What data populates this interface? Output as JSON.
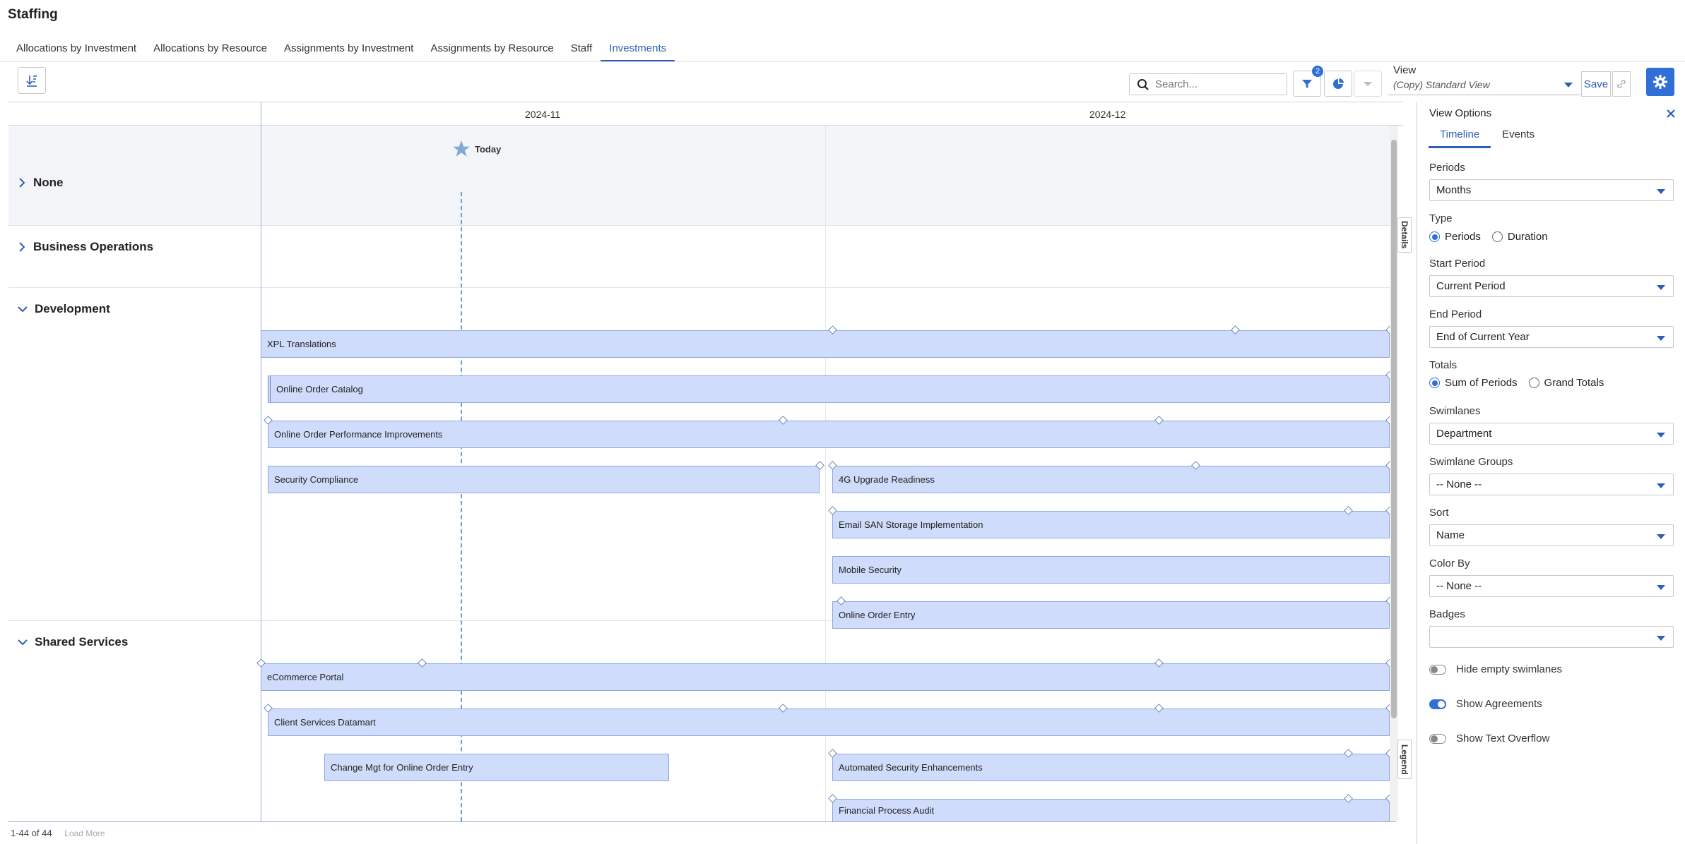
{
  "page": {
    "title": "Staffing"
  },
  "tabs": [
    {
      "label": "Allocations by Investment"
    },
    {
      "label": "Allocations by Resource"
    },
    {
      "label": "Assignments by Investment"
    },
    {
      "label": "Assignments by Resource"
    },
    {
      "label": "Staff"
    },
    {
      "label": "Investments"
    }
  ],
  "active_tab": "Investments",
  "toolbar": {
    "search_placeholder": "Search...",
    "filter_count": "2",
    "view_label": "View",
    "view_value": "(Copy) Standard View",
    "save_label": "Save"
  },
  "timeline": {
    "months": [
      "2024-11",
      "2024-12"
    ],
    "today_label": "Today",
    "swimlanes": [
      {
        "name": "None",
        "expanded": false
      },
      {
        "name": "Business Operations",
        "expanded": false
      },
      {
        "name": "Development",
        "expanded": true
      },
      {
        "name": "Shared Services",
        "expanded": true
      }
    ],
    "bars": [
      "XPL Translations",
      "Online Order Catalog",
      "Online Order Performance Improvements",
      "Security Compliance",
      "4G Upgrade Readiness",
      "Email SAN Storage Implementation",
      "Mobile Security",
      "Online Order Entry",
      "eCommerce Portal",
      "Client Services Datamart",
      "Change Mgt for Online Order Entry",
      "Automated Security Enhancements",
      "Financial Process Audit"
    ],
    "side_tabs": {
      "details": "Details",
      "legend": "Legend"
    }
  },
  "footer": {
    "count": "1-44 of 44",
    "load_more": "Load More"
  },
  "view_options": {
    "title": "View Options",
    "tabs": [
      "Timeline",
      "Events"
    ],
    "periods": {
      "label": "Periods",
      "value": "Months"
    },
    "type": {
      "label": "Type",
      "options": [
        "Periods",
        "Duration"
      ],
      "selected": "Periods"
    },
    "start_period": {
      "label": "Start Period",
      "value": "Current Period"
    },
    "end_period": {
      "label": "End Period",
      "value": "End of Current Year"
    },
    "totals": {
      "label": "Totals",
      "options": [
        "Sum of Periods",
        "Grand Totals"
      ],
      "selected": "Sum of Periods"
    },
    "swimlanes": {
      "label": "Swimlanes",
      "value": "Department"
    },
    "swimlane_groups": {
      "label": "Swimlane Groups",
      "value": "-- None --"
    },
    "sort": {
      "label": "Sort",
      "value": "Name"
    },
    "color_by": {
      "label": "Color By",
      "value": "-- None --"
    },
    "badges": {
      "label": "Badges",
      "value": ""
    },
    "toggles": [
      {
        "label": "Hide empty swimlanes",
        "on": false
      },
      {
        "label": "Show Agreements",
        "on": true
      },
      {
        "label": "Show Text Overflow",
        "on": false
      }
    ]
  },
  "colors": {
    "accent": "#2f6fd6",
    "bar_fill": "#cfdcfb",
    "bar_border": "#8fa9df",
    "today_line": "#6aa0d8"
  }
}
